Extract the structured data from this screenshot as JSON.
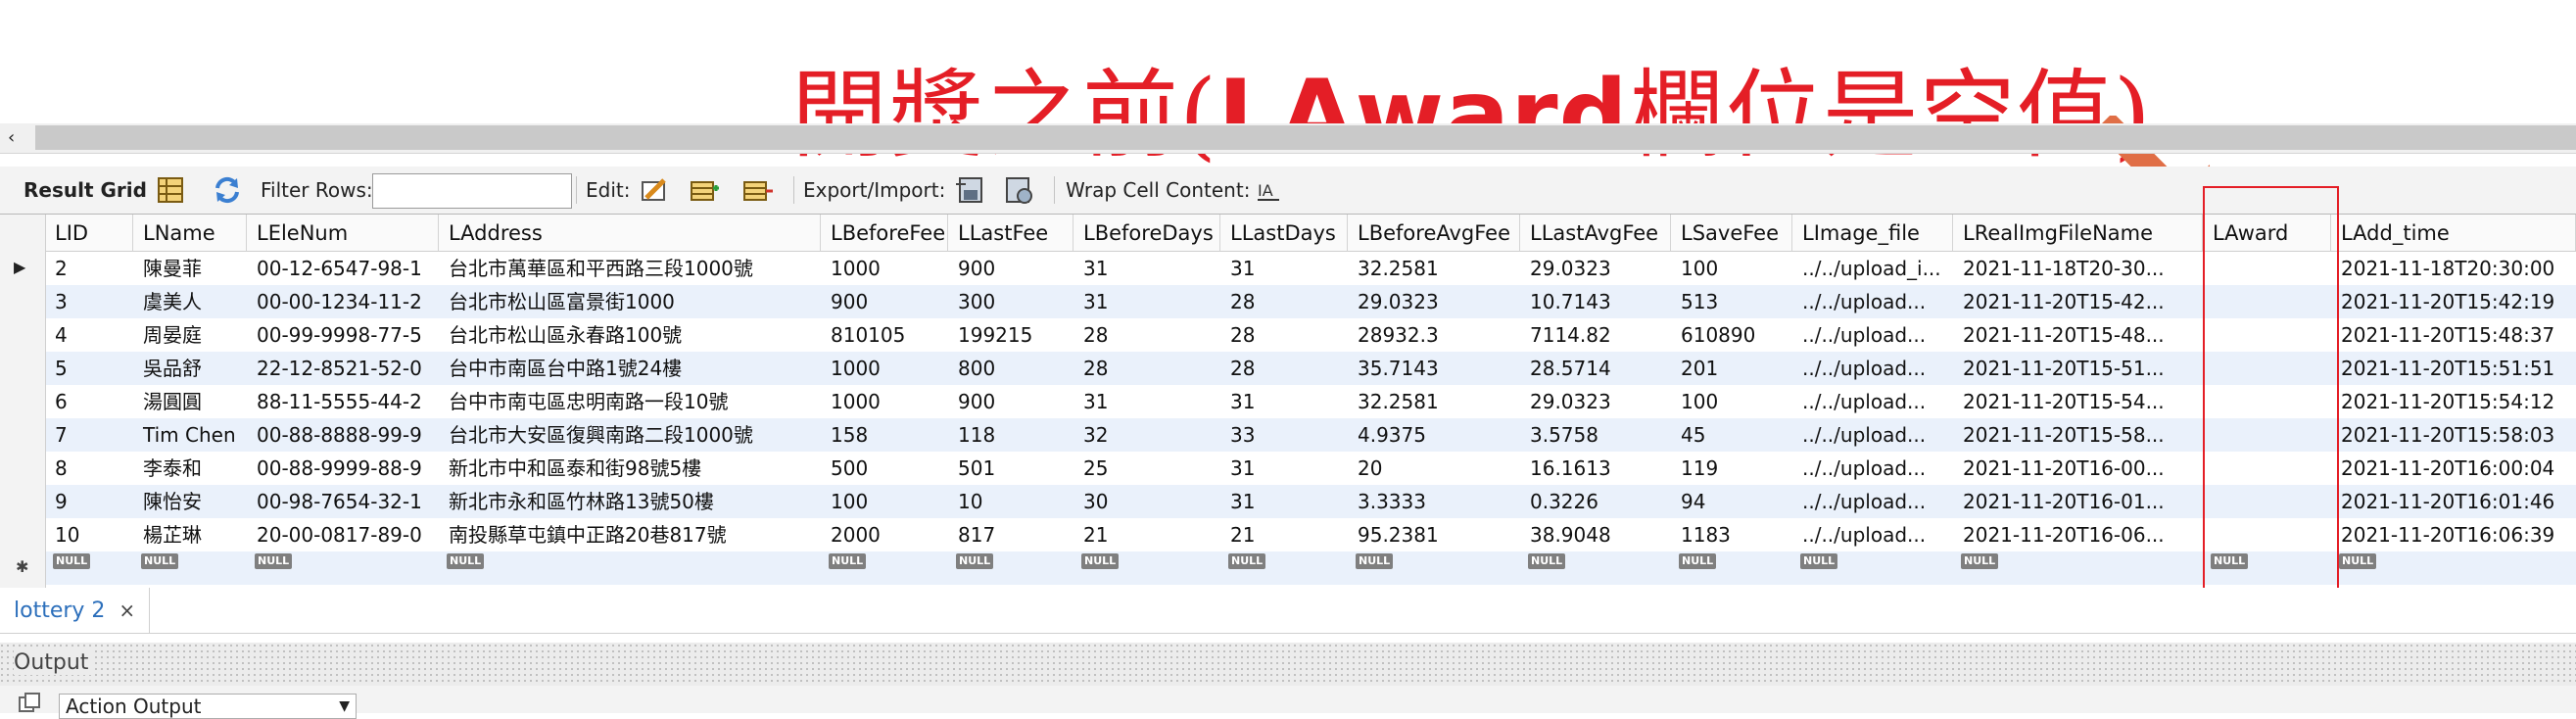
{
  "annotation": {
    "title_prefix": "開獎之前(",
    "title_bold": "LAward",
    "title_suffix": "欄位是空值)",
    "color": "#e41e26"
  },
  "toolbar": {
    "result_grid_label": "Result Grid",
    "filter_rows_label": "Filter Rows:",
    "filter_rows_value": "",
    "edit_label": "Edit:",
    "export_import_label": "Export/Import:",
    "wrap_cell_label": "Wrap Cell Content:"
  },
  "columns": [
    "LID",
    "LName",
    "LEleNum",
    "LAddress",
    "LBeforeFee",
    "LLastFee",
    "LBeforeDays",
    "LLastDays",
    "LBeforeAvgFee",
    "LLastAvgFee",
    "LSaveFee",
    "LImage_file",
    "LRealImgFileName",
    "LAward",
    "LAdd_time"
  ],
  "rows": [
    [
      "2",
      "陳曼菲",
      "00-12-6547-98-1",
      "台北市萬華區和平西路三段1000號",
      "1000",
      "900",
      "31",
      "31",
      "32.2581",
      "29.0323",
      "100",
      "../../upload_i...",
      "2021-11-18T20-30...",
      "",
      "2021-11-18T20:30:00"
    ],
    [
      "3",
      "虞美人",
      "00-00-1234-11-2",
      "台北市松山區富景街1000",
      "900",
      "300",
      "31",
      "28",
      "29.0323",
      "10.7143",
      "513",
      "../../upload...",
      "2021-11-20T15-42...",
      "",
      "2021-11-20T15:42:19"
    ],
    [
      "4",
      "周晏庭",
      "00-99-9998-77-5",
      "台北市松山區永春路100號",
      "810105",
      "199215",
      "28",
      "28",
      "28932.3",
      "7114.82",
      "610890",
      "../../upload...",
      "2021-11-20T15-48...",
      "",
      "2021-11-20T15:48:37"
    ],
    [
      "5",
      "吳品舒",
      "22-12-8521-52-0",
      "台中市南區台中路1號24樓",
      "1000",
      "800",
      "28",
      "28",
      "35.7143",
      "28.5714",
      "201",
      "../../upload...",
      "2021-11-20T15-51...",
      "",
      "2021-11-20T15:51:51"
    ],
    [
      "6",
      "湯圓圓",
      "88-11-5555-44-2",
      "台中市南屯區忠明南路一段10號",
      "1000",
      "900",
      "31",
      "31",
      "32.2581",
      "29.0323",
      "100",
      "../../upload...",
      "2021-11-20T15-54...",
      "",
      "2021-11-20T15:54:12"
    ],
    [
      "7",
      "Tim Chen",
      "00-88-8888-99-9",
      "台北市大安區復興南路二段1000號",
      "158",
      "118",
      "32",
      "33",
      "4.9375",
      "3.5758",
      "45",
      "../../upload...",
      "2021-11-20T15-58...",
      "",
      "2021-11-20T15:58:03"
    ],
    [
      "8",
      "李泰和",
      "00-88-9999-88-9",
      "新北市中和區泰和街98號5樓",
      "500",
      "501",
      "25",
      "31",
      "20",
      "16.1613",
      "119",
      "../../upload...",
      "2021-11-20T16-00...",
      "",
      "2021-11-20T16:00:04"
    ],
    [
      "9",
      "陳怡安",
      "00-98-7654-32-1",
      "新北市永和區竹林路13號50樓",
      "100",
      "10",
      "30",
      "31",
      "3.3333",
      "0.3226",
      "94",
      "../../upload...",
      "2021-11-20T16-01...",
      "",
      "2021-11-20T16:01:46"
    ],
    [
      "10",
      "楊芷琳",
      "20-00-0817-89-0",
      "南投縣草屯鎮中正路20巷817號",
      "2000",
      "817",
      "21",
      "21",
      "95.2381",
      "38.9048",
      "1183",
      "../../upload...",
      "2021-11-20T16-06...",
      "",
      "2021-11-20T16:06:39"
    ]
  ],
  "null_badge": "NULL",
  "tab": {
    "label": "lottery 2",
    "close": "×"
  },
  "output": {
    "label": "Output",
    "action_select": "Action Output"
  }
}
